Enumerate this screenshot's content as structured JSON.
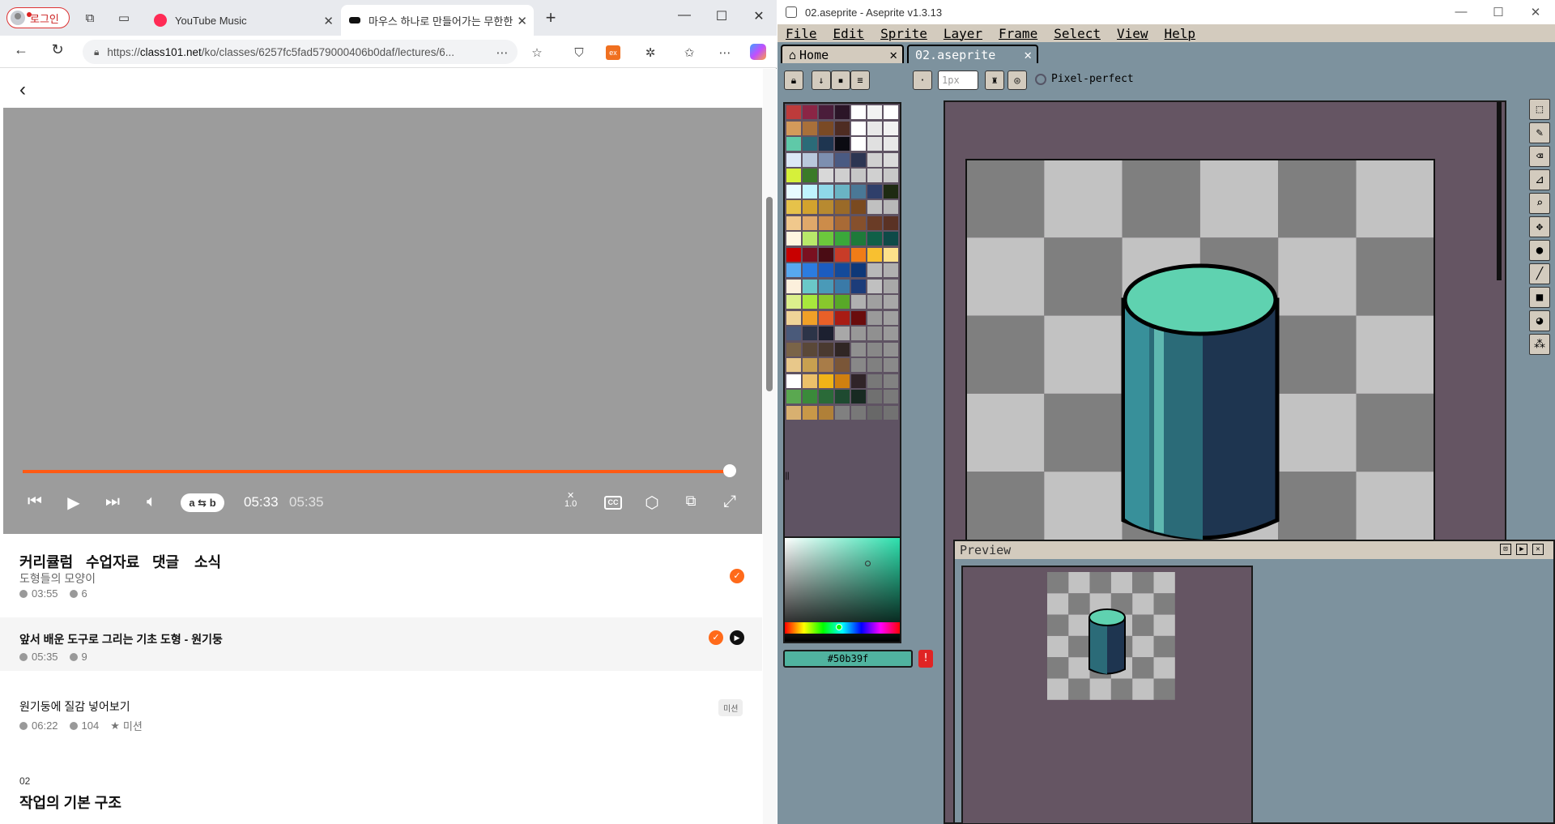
{
  "browser": {
    "profile_label": "로그인",
    "tabs": [
      {
        "title": "YouTube Music",
        "favicon_color": "#f03",
        "active": false
      },
      {
        "title": "마우스 하나로 만들어가는 무한한",
        "favicon_color": "#111",
        "active": true
      }
    ],
    "url_prefix": "https://",
    "url_host": "class101.net",
    "url_path": "/ko/classes/6257fc5fad579000406b0daf/lectures/6...",
    "player": {
      "current_time": "05:33",
      "total_time": "05:35",
      "progress": 0.994,
      "ab_label": "a ⇆ b",
      "speed_label": "1.0",
      "cc_label": "CC"
    },
    "page_tabs": [
      "커리큘럼",
      "수업자료",
      "댓글",
      "소식"
    ],
    "lessons": [
      {
        "title": "도형들의 모양이",
        "duration": "03:55",
        "comments": "6",
        "mission": "",
        "completed": true,
        "playing": false
      },
      {
        "title": "앞서 배운 도구로 그리는 기초 도형 - 원기둥",
        "duration": "05:35",
        "comments": "9",
        "mission": "",
        "completed": true,
        "playing": true
      },
      {
        "title": "원기둥에 질감 넣어보기",
        "duration": "06:22",
        "comments": "104",
        "mission": "미션",
        "badge": "미션",
        "completed": false,
        "playing": false
      }
    ],
    "section": {
      "number": "02",
      "title": "작업의 기본 구조"
    }
  },
  "aseprite": {
    "window_title": "02.aseprite - Aseprite v1.3.13",
    "menu": [
      "File",
      "Edit",
      "Sprite",
      "Layer",
      "Frame",
      "Select",
      "View",
      "Help"
    ],
    "tabs": [
      {
        "label": "Home"
      },
      {
        "label": "02.aseprite"
      }
    ],
    "brush_size": "1px",
    "pixel_perfect_label": "Pixel-perfect",
    "hex_color": "#50b39f",
    "preview_title": "Preview",
    "palette_colors": [
      "#be3b3b",
      "#8b2545",
      "#4a1d3a",
      "#2b1527",
      "#ffffff",
      "#f2f2f2",
      "#ffffff",
      "#d49a5a",
      "#a9703a",
      "#7a4a25",
      "#4e2c22",
      "#ffffff",
      "#e8e8e8",
      "#f2f2f2",
      "#5fc9a8",
      "#2b6b78",
      "#1e3550",
      "#0b0b12",
      "#ffffff",
      "#e0e0e0",
      "#e8e8e8",
      "#dce8f6",
      "#b9c8dc",
      "#7d8fb0",
      "#4a5a82",
      "#2c3552",
      "#d0d0d0",
      "#dadada",
      "#d6f03a",
      "#3a7a28",
      "#d8d8d8",
      "#cfcfcf",
      "#c6c6c6",
      "#d0d0d0",
      "#c8c8c8",
      "#e8fbff",
      "#bff3ff",
      "#8fd8e8",
      "#6ab4c4",
      "#4a7896",
      "#2f3f6a",
      "#1e2a12",
      "#e6c24a",
      "#d2a22e",
      "#b88a30",
      "#9a6a28",
      "#7a4a20",
      "#c0c0c0",
      "#b8b8b8",
      "#f0c88c",
      "#e0a86a",
      "#cc8c4a",
      "#a86a36",
      "#86502c",
      "#6a3c26",
      "#5a3224",
      "#fff6e0",
      "#b8e86a",
      "#6cc83c",
      "#3aa83a",
      "#1e7a3a",
      "#106048",
      "#0e4a48",
      "#c80000",
      "#7a1020",
      "#4a0c14",
      "#c83c28",
      "#f07c18",
      "#f8c030",
      "#fce08a",
      "#58a8f0",
      "#2c7ce0",
      "#1c5cc0",
      "#144a9a",
      "#0e3878",
      "#b8b8b8",
      "#b0b0b0",
      "#fcf0dc",
      "#6ac8c8",
      "#4a9ab8",
      "#3a7aa8",
      "#1c3c7a",
      "#c0c0c0",
      "#a8a8a8",
      "#dcf08c",
      "#a8e83c",
      "#88c82c",
      "#58a828",
      "#b0b0b0",
      "#a0a0a0",
      "#a8a8a8",
      "#f0d498",
      "#f0a028",
      "#e86028",
      "#a81c14",
      "#6a0c0c",
      "#9a9a9a",
      "#a0a0a0",
      "#4a5a7a",
      "#2c3448",
      "#1c2030",
      "#a8a8a8",
      "#989898",
      "#909090",
      "#9a9a9a",
      "#7a6448",
      "#5a4838",
      "#4a3a30",
      "#302624",
      "#909090",
      "#888888",
      "#929292",
      "#e8c88a",
      "#c8a050",
      "#a87c48",
      "#7a5638",
      "#888888",
      "#808080",
      "#8a8a8a",
      "#ffffff",
      "#ecc06a",
      "#f0b418",
      "#d08010",
      "#302428",
      "#787878",
      "#828282",
      "#5aa850",
      "#3a8a3a",
      "#2a6a38",
      "#1e4a30",
      "#182a22",
      "#707070",
      "#7a7a7a",
      "#d8b070",
      "#c89848",
      "#b08038",
      "#808080",
      "#787878",
      "#686868",
      "#727272"
    ],
    "tools": [
      "rectangular-marquee",
      "pencil",
      "eraser",
      "eyedropper",
      "zoom",
      "move",
      "paint-bucket",
      "line",
      "rectangle",
      "ellipse",
      "spray"
    ]
  }
}
